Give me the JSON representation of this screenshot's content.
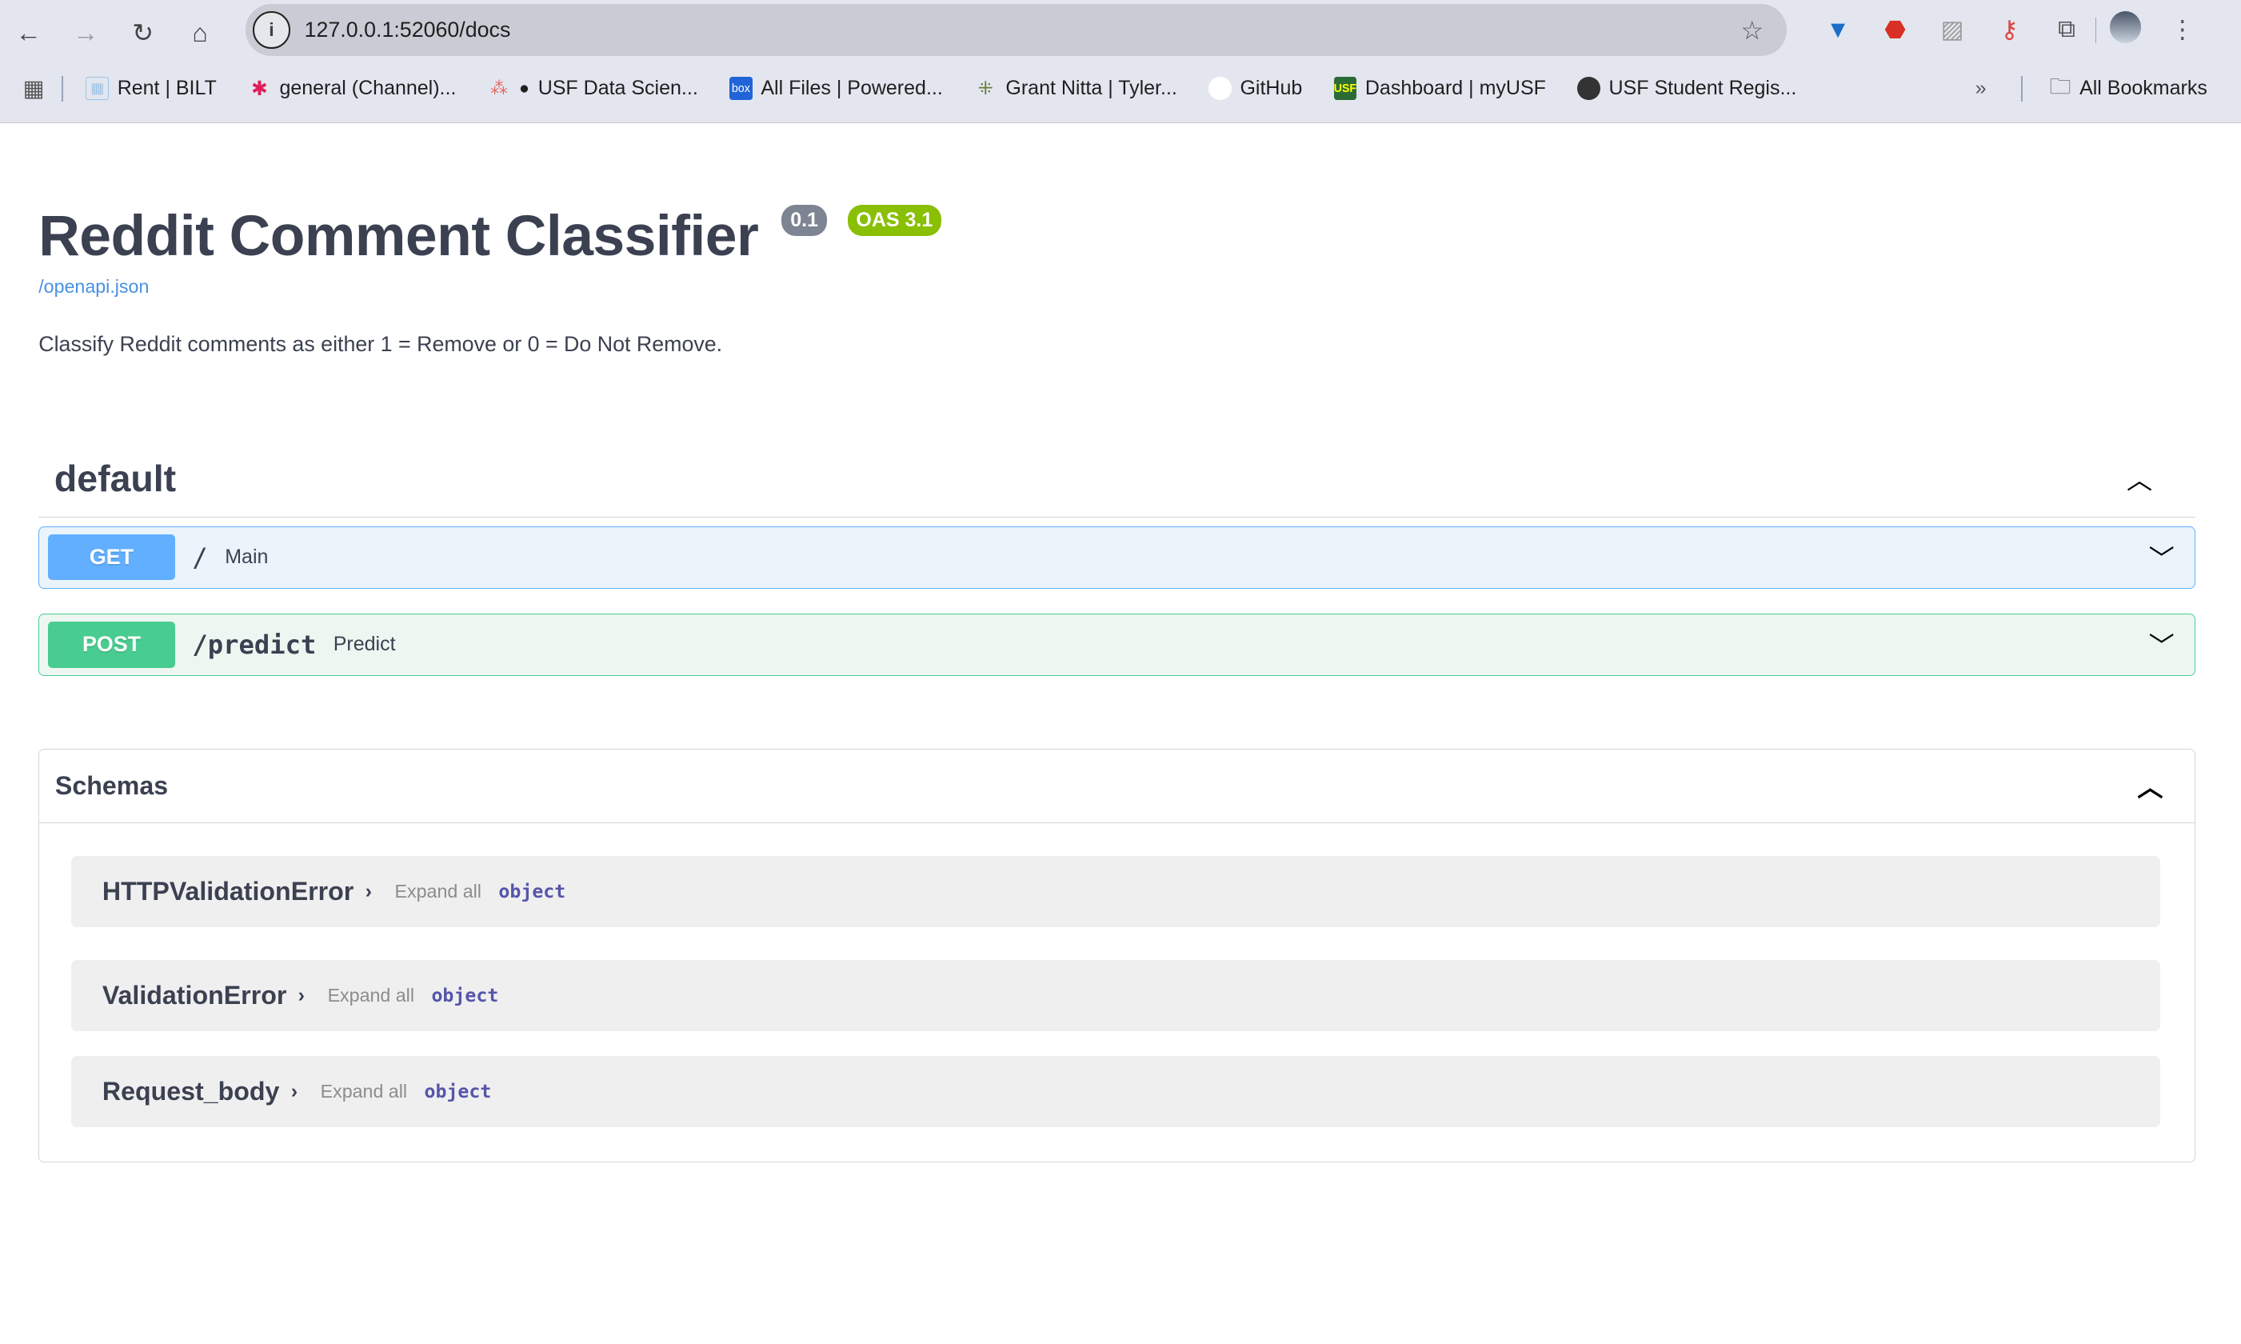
{
  "browser": {
    "url": "127.0.0.1:52060/docs",
    "bookmarks": [
      "Rent | BILT",
      "general (Channel)...",
      "USF Data Scien...",
      "All Files | Powered...",
      "Grant Nitta | Tyler...",
      "GitHub",
      "Dashboard | myUSF",
      "USF Student Regis..."
    ],
    "bookmark_icons": [
      "table-icon",
      "slack-icon",
      "asana-icon",
      "box-icon",
      "network-icon",
      "github-icon",
      "usf-icon",
      "globe-icon"
    ],
    "all_bookmarks": "All Bookmarks",
    "box_label": "box",
    "usf_label": "USF"
  },
  "info": {
    "title": "Reddit Comment Classifier",
    "version": "0.1",
    "oas": "OAS 3.1",
    "spec_link": "/openapi.json",
    "description": "Classify Reddit comments as either 1 = Remove or 0 = Do Not Remove."
  },
  "tag": {
    "name": "default"
  },
  "operations": [
    {
      "method": "GET",
      "path": "/",
      "summary": "Main",
      "color": "#61affe"
    },
    {
      "method": "POST",
      "path": "/predict",
      "summary": "Predict",
      "color": "#49cc90"
    }
  ],
  "schemas": {
    "title": "Schemas",
    "models": [
      {
        "name": "HTTPValidationError",
        "expand": "Expand all",
        "type": "object"
      },
      {
        "name": "ValidationError",
        "expand": "Expand all",
        "type": "object"
      },
      {
        "name": "Request_body",
        "expand": "Expand all",
        "type": "object"
      }
    ]
  },
  "colors": {
    "version_badge": "#7d8492",
    "oas_badge": "#89bf04",
    "link": "#4990e2"
  }
}
